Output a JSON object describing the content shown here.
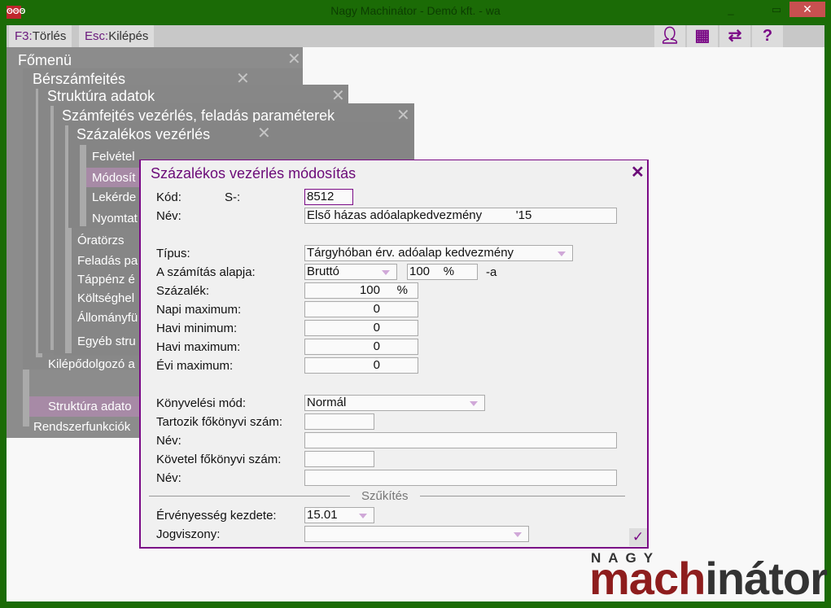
{
  "window": {
    "title": "Nagy Machinátor - Demó kft. - wa",
    "app_icon": "app-logo-icon"
  },
  "toolbar": {
    "f3_key": "F3:",
    "f3_label": "Törlés",
    "esc_key": "Esc:",
    "esc_label": "Kilépés",
    "icons": [
      "user-icon",
      "grid-icon",
      "swap-icon",
      "help-icon"
    ]
  },
  "menu": {
    "fomenu": "Főmenü",
    "berszamfejtes": "Bérszámfejtés",
    "struktura": "Struktúra adatok",
    "szamfejtes": "Számfejtés vezérlés, feladás paraméterek",
    "szazalekos": "Százalékos vezérlés",
    "sub_items": [
      "Felvétel",
      "Módosít",
      "Lekérde",
      "Nyomtat"
    ],
    "struct_items": [
      "Óratörzs",
      "Feladás pa",
      "Táppénz é",
      "Költséghel",
      "Állományfü",
      "Egyéb stru"
    ],
    "kilepo": "Kilépődolgozó a",
    "struktura_adato": "Struktúra adato",
    "rendszer": "Rendszerfunkciók"
  },
  "dialog": {
    "title": "Százalékos vezérlés módosítás",
    "kod_label": "Kód:",
    "kod_prefix": "S-:",
    "kod_value": "8512",
    "nev_label": "Név:",
    "nev_value": "Első házas adóalapkedvezmény          '15",
    "tipus_label": "Típus:",
    "tipus_value": "Tárgyhóban érv. adóalap kedvezmény",
    "alap_label": "A számítás alapja:",
    "alap_value": "Bruttó",
    "alap_pct": "100    %",
    "alap_suffix": "-a",
    "szazalek_label": "Százalék:",
    "szazalek_value": "100",
    "pct": "%",
    "napi_max_label": "Napi maximum:",
    "napi_max": "0",
    "havi_min_label": "Havi minimum:",
    "havi_min": "0",
    "havi_max_label": "Havi maximum:",
    "havi_max": "0",
    "evi_max_label": "Évi maximum:",
    "evi_max": "0",
    "konyv_label": "Könyvelési mód:",
    "konyv_value": "Normál",
    "tartozik_label": "Tartozik főkönyvi szám:",
    "tartozik_value": "",
    "nev2_label": "Név:",
    "nev2_value": "",
    "kovetel_label": "Követel főkönyvi szám:",
    "kovetel_value": "",
    "nev3_label": "Név:",
    "nev3_value": "",
    "szukites": "Szűkítés",
    "erv_label": "Érvényesség kezdete:",
    "erv_value": "15.01",
    "jogv_label": "Jogviszony:",
    "jogv_value": ""
  },
  "logo": {
    "top": "NAGY",
    "brand": "machinátor"
  }
}
